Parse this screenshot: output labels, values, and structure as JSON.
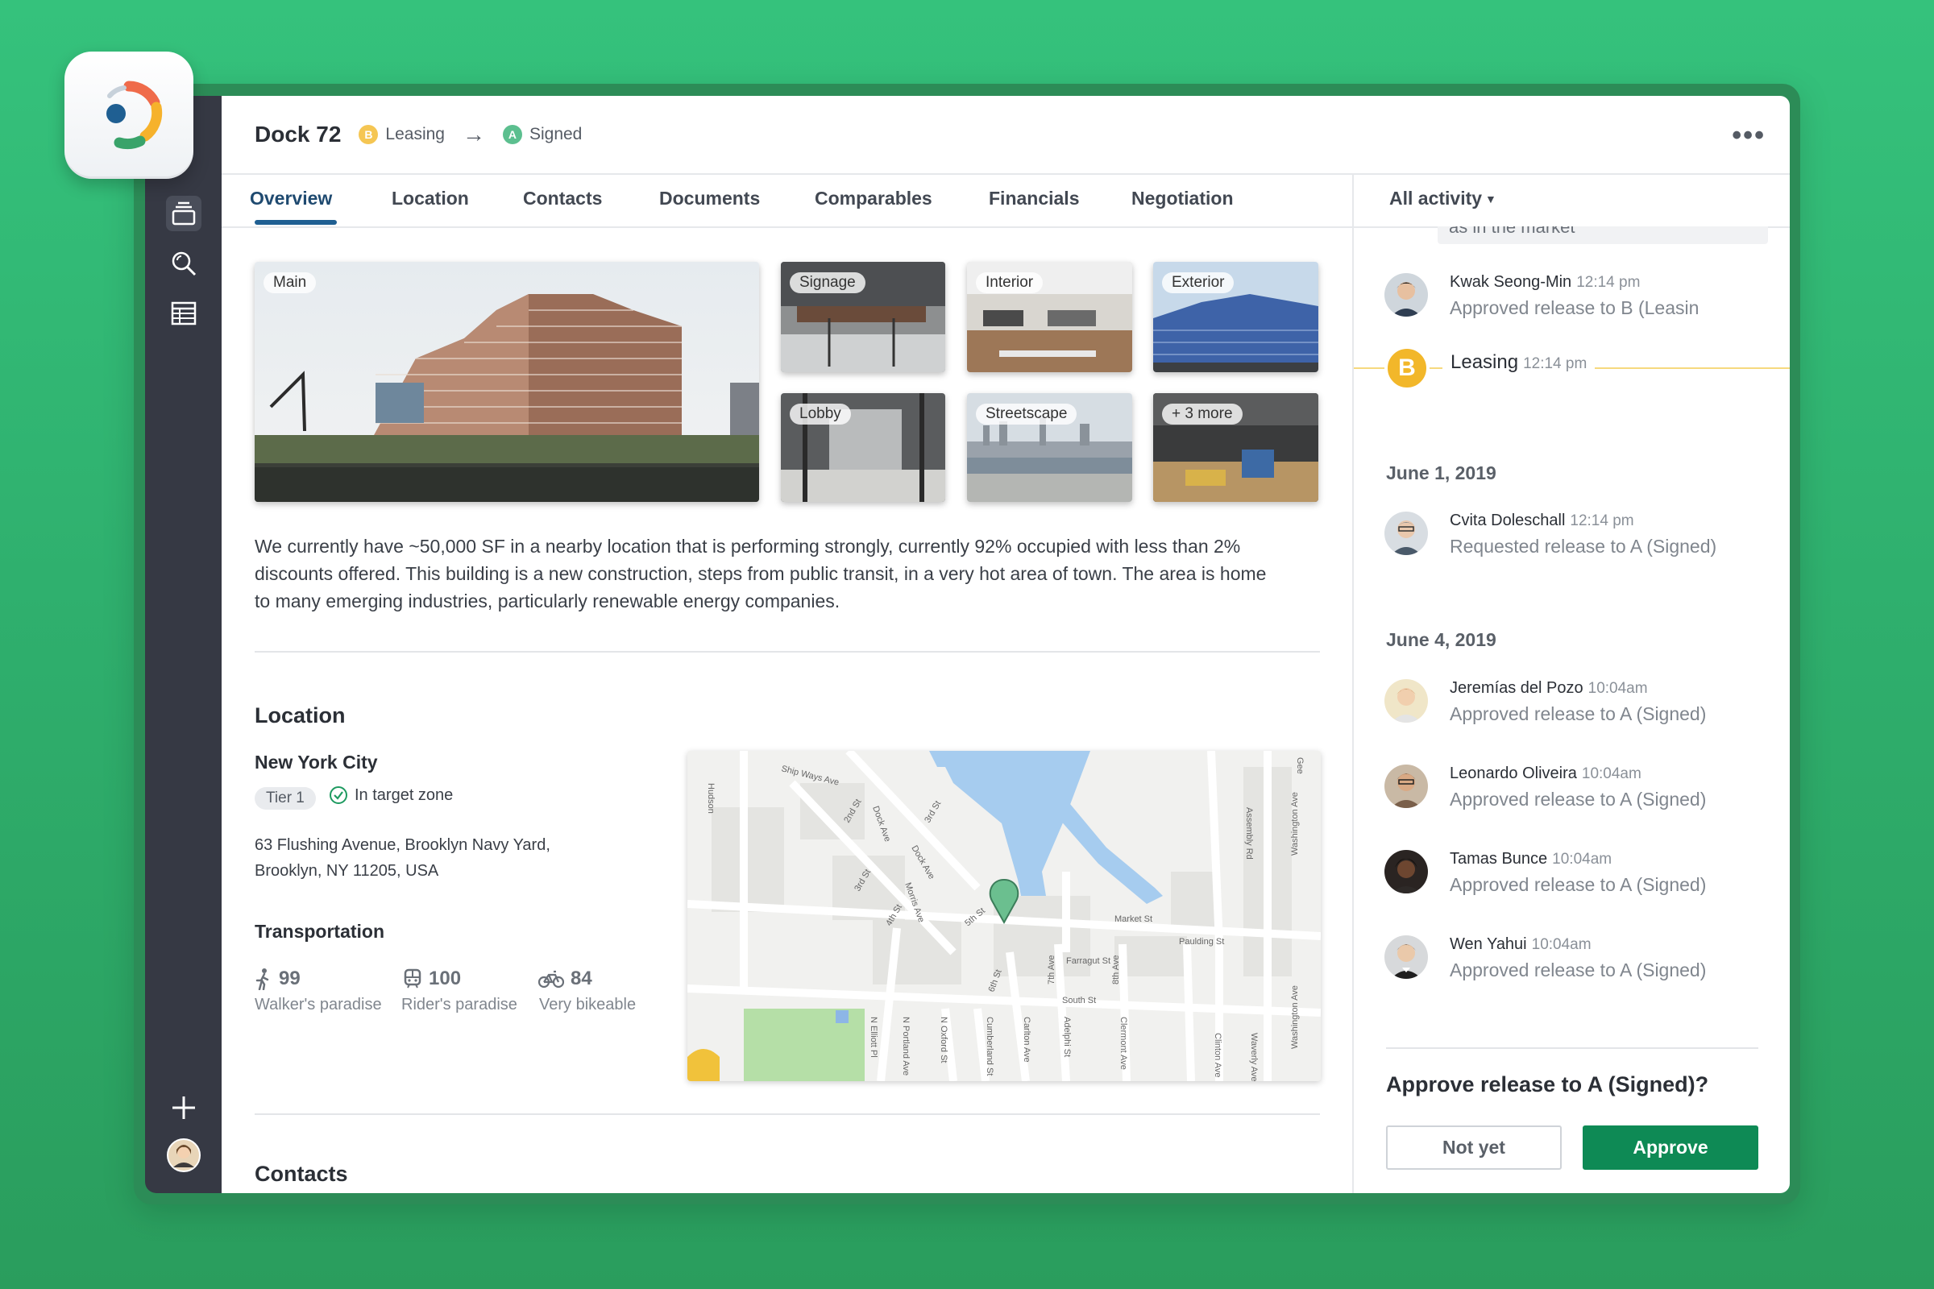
{
  "app": {
    "title": "Dock 72",
    "stage_from": {
      "letter": "B",
      "label": "Leasing",
      "color": "#f5c653"
    },
    "stage_to": {
      "letter": "A",
      "label": "Signed",
      "color": "#5cbf8f"
    },
    "more_label": "•••"
  },
  "tabs": [
    "Overview",
    "Location",
    "Contacts",
    "Documents",
    "Comparables",
    "Financials",
    "Negotiation"
  ],
  "photos": {
    "main": "Main",
    "signage": "Signage",
    "interior": "Interior",
    "exterior": "Exterior",
    "lobby": "Lobby",
    "streetscape": "Streetscape",
    "more": "+ 3 more"
  },
  "description": "We currently have ~50,000 SF in a nearby location that is performing strongly, currently 92% occupied with less than 2% discounts offered. This building is a new construction, steps from public transit, in a very hot area of town. The area is home to many emerging industries, particularly renewable energy companies.",
  "location": {
    "heading": "Location",
    "city": "New York City",
    "tier": "Tier 1",
    "zone": "In target zone",
    "address_line1": "63 Flushing Avenue, Brooklyn Navy Yard,",
    "address_line2": "Brooklyn, NY 11205, USA",
    "transport_heading": "Transportation",
    "walk": {
      "score": "99",
      "desc": "Walker's paradise"
    },
    "transit": {
      "score": "100",
      "desc": "Rider's paradise"
    },
    "bike": {
      "score": "84",
      "desc": "Very bikeable"
    }
  },
  "map_labels": {
    "ship_ways": "Ship Ways Ave",
    "market_st": "Market St",
    "farragut_st": "Farragut St",
    "paulding_st": "Paulding St",
    "south_st": "South St",
    "hudson": "Hudson",
    "assembly_rd": "Assembly Rd",
    "washington_ave": "Washington Ave",
    "washington_ave_2": "Washington Ave",
    "dock_ave": "Dock Ave",
    "morris_ave": "Morris Ave",
    "st_2nd": "2nd St",
    "st_3rd": "3rd St",
    "st_4th": "4th St",
    "st_5th": "5th St",
    "st_6th": "6th St",
    "ave_7th": "7th Ave",
    "ave_8th": "8th Ave",
    "n_elliott": "N Elliott Pl",
    "n_portland": "N Portland Ave",
    "n_oxford": "N Oxford St",
    "cumberland": "Cumberland St",
    "carlton": "Carlton Ave",
    "adelphi": "Adelphi St",
    "clermont": "Clermont Ave",
    "clinton": "Clinton Ave",
    "waverly": "Waverly Ave",
    "gee": "Gee"
  },
  "contacts_heading": "Contacts",
  "activity": {
    "filter": "All activity",
    "cut_text": "as in the market",
    "entries_top": [
      {
        "name": "Kwak Seong-Min",
        "time": "12:14 pm",
        "action": "Approved release to B (Leasin"
      }
    ],
    "stage_event": {
      "letter": "B",
      "label": "Leasing",
      "time": "12:14 pm"
    },
    "groups": [
      {
        "date": "June 1, 2019",
        "entries": [
          {
            "name": "Cvita Doleschall",
            "time": "12:14 pm",
            "action": "Requested release to A (Signed)"
          }
        ]
      },
      {
        "date": "June 4, 2019",
        "entries": [
          {
            "name": "Jeremías del Pozo",
            "time": "10:04am",
            "action": "Approved release to A (Signed)"
          },
          {
            "name": "Leonardo Oliveira",
            "time": "10:04am",
            "action": "Approved release to A (Signed)"
          },
          {
            "name": "Tamas Bunce",
            "time": "10:04am",
            "action": "Approved release to A (Signed)"
          },
          {
            "name": "Wen Yahui",
            "time": "10:04am",
            "action": "Approved release to A (Signed)"
          }
        ]
      }
    ],
    "approve_question": "Approve release to A (Signed)?",
    "not_yet_label": "Not yet",
    "approve_label": "Approve"
  },
  "colors": {
    "background": "#32b974",
    "sidebar": "#363944",
    "accent": "#1f5f92",
    "approve": "#0e8a55",
    "leasing": "#f2b72a"
  },
  "icons": {
    "sidebar": [
      "stack-icon",
      "search-icon",
      "table-icon",
      "plus-icon",
      "avatar"
    ],
    "check": "check-circle-icon",
    "walk": "walk-icon",
    "transit": "train-icon",
    "bike": "bike-icon",
    "dropdown": "caret-down-icon",
    "arrow": "arrow-right-icon"
  }
}
